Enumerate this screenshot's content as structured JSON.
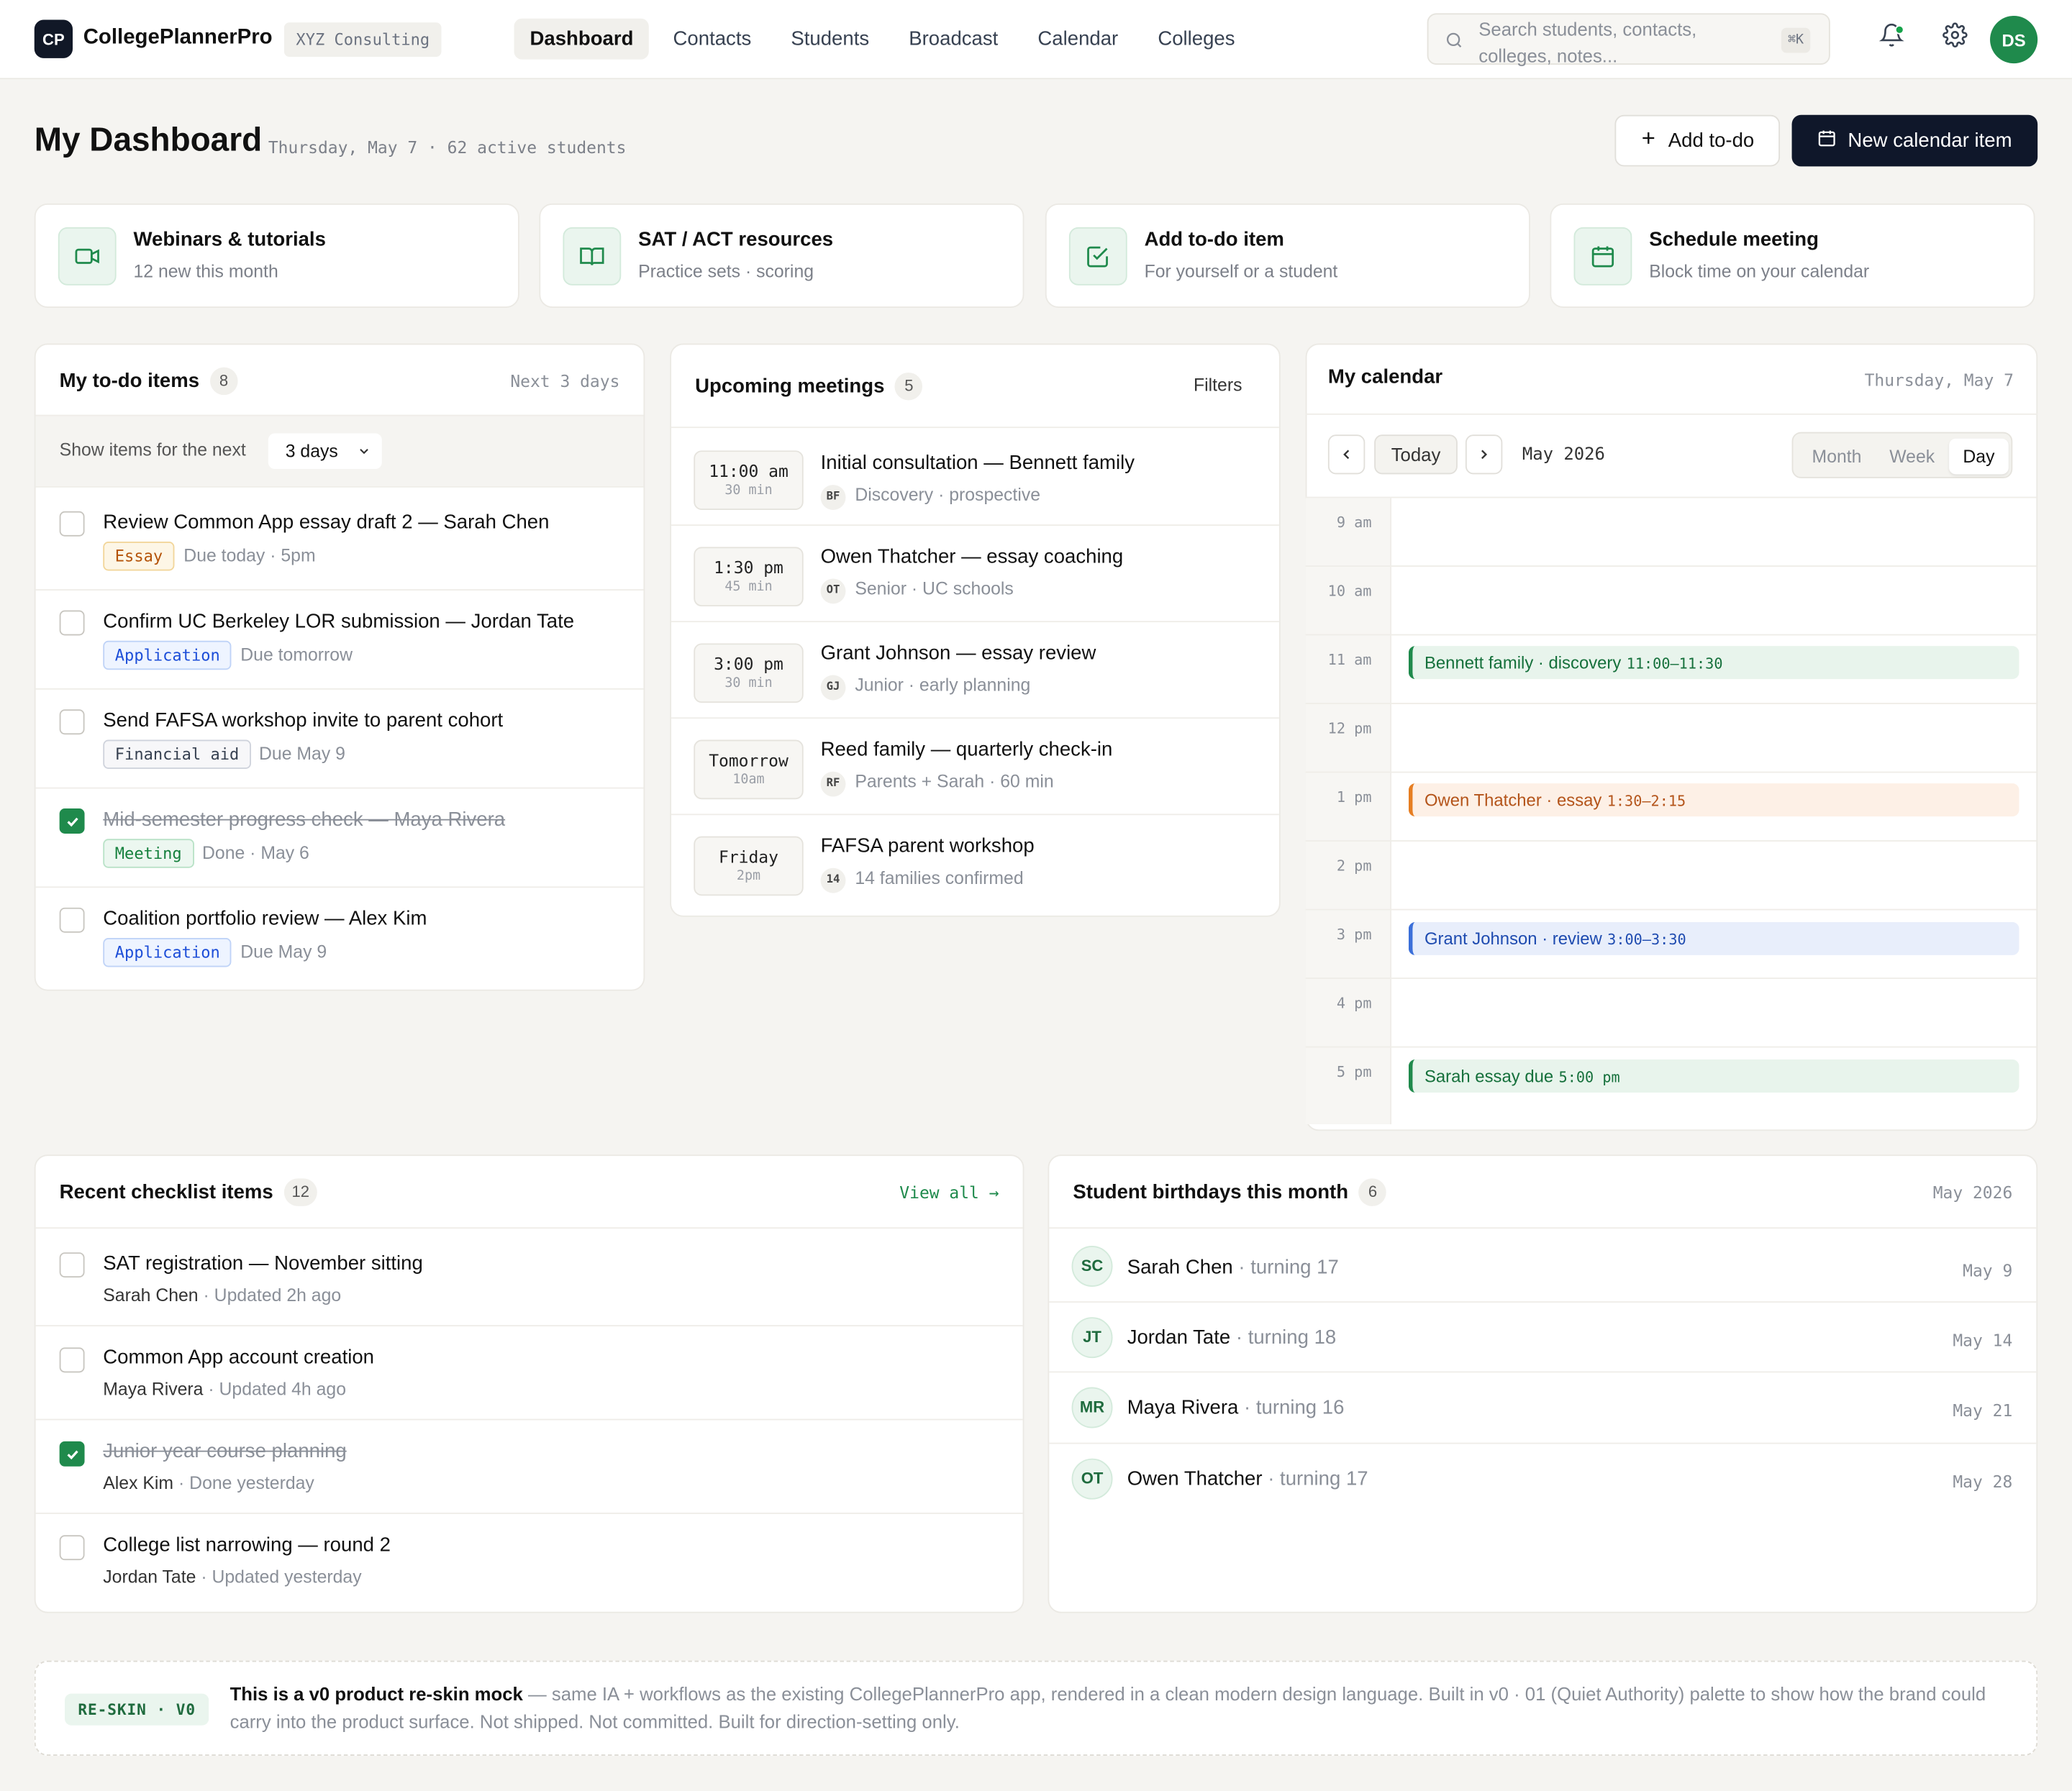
{
  "app": {
    "logo": "CP",
    "name": "CollegePlannerPro",
    "org": "XYZ Consulting"
  },
  "nav": [
    "Dashboard",
    "Contacts",
    "Students",
    "Broadcast",
    "Calendar",
    "Colleges"
  ],
  "search": {
    "placeholder": "Search students, contacts, colleges, notes...",
    "shortcut": "⌘K"
  },
  "user": {
    "initials": "DS"
  },
  "header": {
    "title": "My Dashboard",
    "subtitle": "Thursday, May 7 · 62 active students",
    "add_todo": "Add to-do",
    "new_item": "New calendar item"
  },
  "quick": [
    {
      "title": "Webinars & tutorials",
      "sub": "12 new this month",
      "icon": "video-icon"
    },
    {
      "title": "SAT / ACT resources",
      "sub": "Practice sets · scoring",
      "icon": "book-icon"
    },
    {
      "title": "Add to-do item",
      "sub": "For yourself or a student",
      "icon": "check-square-icon"
    },
    {
      "title": "Schedule meeting",
      "sub": "Block time on your calendar",
      "icon": "calendar-icon"
    }
  ],
  "todo": {
    "title": "My to-do items",
    "count": "8",
    "meta": "Next 3 days",
    "filter_label": "Show items for the next",
    "filter_value": "3 days",
    "items": [
      {
        "title": "Review Common App essay draft 2 — Sarah Chen",
        "tag": "Essay",
        "due": "Due today · 5pm",
        "done": false
      },
      {
        "title": "Confirm UC Berkeley LOR submission — Jordan Tate",
        "tag": "Application",
        "due": "Due tomorrow",
        "done": false
      },
      {
        "title": "Send FAFSA workshop invite to parent cohort",
        "tag": "Financial aid",
        "due": "Due May 9",
        "done": false
      },
      {
        "title": "Mid-semester progress check — Maya Rivera",
        "tag": "Meeting",
        "due": "Done · May 6",
        "done": true
      },
      {
        "title": "Coalition portfolio review — Alex Kim",
        "tag": "Application",
        "due": "Due May 9",
        "done": false
      }
    ]
  },
  "meetings": {
    "title": "Upcoming meetings",
    "count": "5",
    "filters": "Filters",
    "items": [
      {
        "time": "11:00 am",
        "dur": "30 min",
        "title": "Initial consultation — Bennett family",
        "initials": "BF",
        "sub": "Discovery · prospective"
      },
      {
        "time": "1:30 pm",
        "dur": "45 min",
        "title": "Owen Thatcher — essay coaching",
        "initials": "OT",
        "sub": "Senior · UC schools"
      },
      {
        "time": "3:00 pm",
        "dur": "30 min",
        "title": "Grant Johnson — essay review",
        "initials": "GJ",
        "sub": "Junior · early planning"
      },
      {
        "time": "Tomorrow",
        "dur": "10am",
        "title": "Reed family — quarterly check-in",
        "initials": "RF",
        "sub": "Parents + Sarah · 60 min"
      },
      {
        "time": "Friday",
        "dur": "2pm",
        "title": "FAFSA parent workshop",
        "initials": "14",
        "sub": "14 families confirmed"
      }
    ]
  },
  "calendar": {
    "title": "My calendar",
    "date": "Thursday, May 7",
    "today": "Today",
    "month": "May 2026",
    "views": [
      "Month",
      "Week",
      "Day"
    ],
    "hours": [
      "9 am",
      "10 am",
      "11 am",
      "12 pm",
      "1 pm",
      "2 pm",
      "3 pm",
      "4 pm",
      "5 pm"
    ],
    "events": [
      {
        "label": "Bennett family · discovery",
        "time": "11:00–11:30"
      },
      {
        "label": "Owen Thatcher · essay",
        "time": "1:30–2:15"
      },
      {
        "label": "Grant Johnson · review",
        "time": "3:00–3:30"
      },
      {
        "label": "Sarah essay due",
        "time": "5:00 pm"
      }
    ]
  },
  "checklist": {
    "title": "Recent checklist items",
    "count": "12",
    "view_all": "View all →",
    "items": [
      {
        "title": "SAT registration — November sitting",
        "student": "Sarah Chen",
        "meta": "· Updated 2h ago",
        "done": false
      },
      {
        "title": "Common App account creation",
        "student": "Maya Rivera",
        "meta": "· Updated 4h ago",
        "done": false
      },
      {
        "title": "Junior year course planning",
        "student": "Alex Kim",
        "meta": "· Done yesterday",
        "done": true
      },
      {
        "title": "College list narrowing — round 2",
        "student": "Jordan Tate",
        "meta": "· Updated yesterday",
        "done": false
      }
    ]
  },
  "birthdays": {
    "title": "Student birthdays this month",
    "count": "6",
    "month": "May 2026",
    "items": [
      {
        "initials": "SC",
        "name": "Sarah Chen",
        "turning": "· turning 17",
        "date": "May 9"
      },
      {
        "initials": "JT",
        "name": "Jordan Tate",
        "turning": "· turning 18",
        "date": "May 14"
      },
      {
        "initials": "MR",
        "name": "Maya Rivera",
        "turning": "· turning 16",
        "date": "May 21"
      },
      {
        "initials": "OT",
        "name": "Owen Thatcher",
        "turning": "· turning 17",
        "date": "May 28"
      }
    ]
  },
  "footer": {
    "badge": "RE-SKIN · V0",
    "bold": "This is a v0 product re-skin mock",
    "text": " — same IA + workflows as the existing CollegePlannerPro app, rendered in a clean modern design language. Built in v0 · 01 (Quiet Authority) palette to show how the brand could carry into the product surface. Not shipped. Not committed. Built for direction-setting only."
  },
  "colors": {
    "accent": "#1f8a4c",
    "dark": "#0f172a",
    "background": "#f5f4f1"
  }
}
